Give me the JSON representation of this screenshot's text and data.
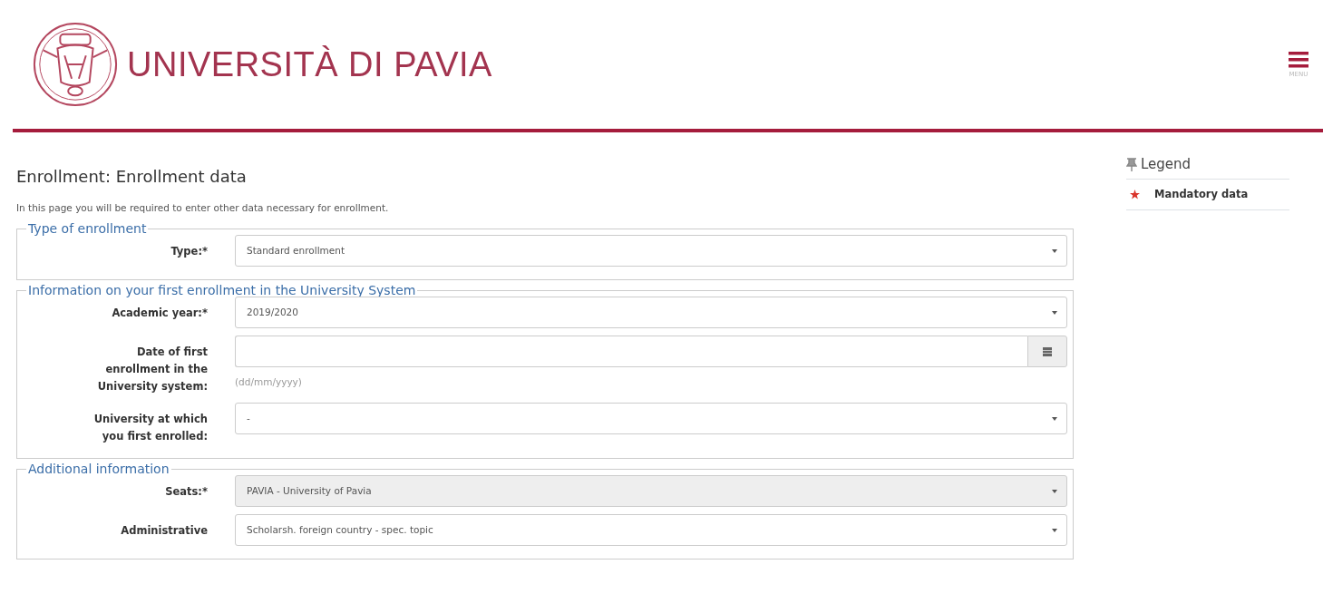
{
  "header": {
    "title": "UNIVERSITÀ DI PAVIA",
    "menu_label": "MENU"
  },
  "page_title": "Enrollment: Enrollment data",
  "intro": "In this page you will be required to enter other data necessary for enrollment.",
  "sections": [
    {
      "legend": "Type of enrollment",
      "fields": [
        {
          "label": "Type:*",
          "kind": "select",
          "value": "Standard enrollment",
          "disabled": false
        }
      ]
    },
    {
      "legend": "Information on your first enrollment in the University System",
      "fields": [
        {
          "label": "Academic year:*",
          "kind": "select",
          "value": "2019/2020",
          "disabled": false
        },
        {
          "label": "Date of first enrollment in the University system:",
          "kind": "date",
          "hint": "(dd/mm/yyyy)"
        },
        {
          "label": "University at which you first enrolled:",
          "kind": "select",
          "value": "-",
          "disabled": false
        }
      ]
    },
    {
      "legend": "Additional information",
      "fields": [
        {
          "label": "Seats:*",
          "kind": "select",
          "value": "PAVIA - University of Pavia",
          "disabled": true
        },
        {
          "label": "Administrative",
          "kind": "select",
          "value": "Scholarsh. foreign country - spec. topic",
          "disabled": false
        }
      ]
    }
  ],
  "legend": {
    "title": "Legend",
    "items": [
      {
        "label": "Mandatory data"
      }
    ]
  }
}
